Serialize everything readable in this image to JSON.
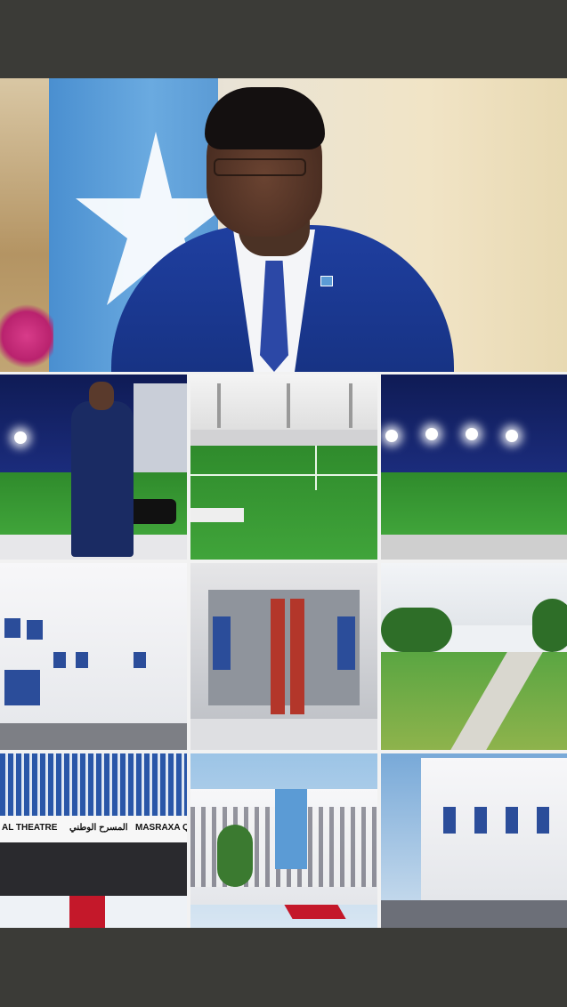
{
  "background_color": "#3b3b37",
  "collage": {
    "hero": {
      "subject": "portrait-leader-with-flag"
    },
    "tiles": [
      {
        "id": "leader-walking-stadium"
      },
      {
        "id": "football-pitch"
      },
      {
        "id": "stadium-night-lights"
      },
      {
        "id": "white-building"
      },
      {
        "id": "modern-entrance"
      },
      {
        "id": "campus-lawn"
      },
      {
        "id": "national-theatre",
        "sign_left": "AL THEATRE",
        "sign_arabic": "المسرح الوطني",
        "sign_right": "MASRAXA Q"
      },
      {
        "id": "building-with-flag-banner"
      },
      {
        "id": "white-office-block"
      }
    ]
  },
  "colors": {
    "flag_blue": "#4a8fd0",
    "suit_blue": "#1f3fa0",
    "grass_green": "#3a9a35",
    "carpet_red": "#c4182a"
  }
}
